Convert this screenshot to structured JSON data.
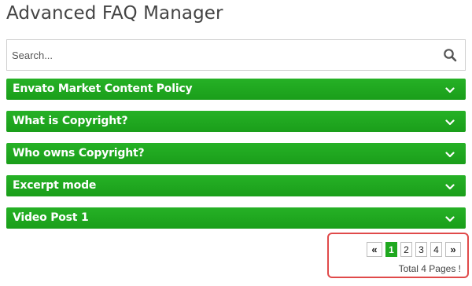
{
  "page": {
    "title": "Advanced FAQ Manager"
  },
  "search": {
    "placeholder": "Search...",
    "value": "",
    "icon": "search-icon"
  },
  "faq": {
    "accent_color": "#1fa81f",
    "items": [
      {
        "title": "Envato Market Content Policy",
        "expanded": false
      },
      {
        "title": "What is Copyright?",
        "expanded": false
      },
      {
        "title": "Who owns Copyright?",
        "expanded": false
      },
      {
        "title": "Excerpt mode",
        "expanded": false
      },
      {
        "title": "Video Post 1",
        "expanded": false
      }
    ]
  },
  "pagination": {
    "prev_label": "«",
    "next_label": "»",
    "pages": [
      "1",
      "2",
      "3",
      "4"
    ],
    "current_page": 1,
    "total_text": "Total 4 Pages !",
    "highlight_color": "#e04a4a"
  }
}
